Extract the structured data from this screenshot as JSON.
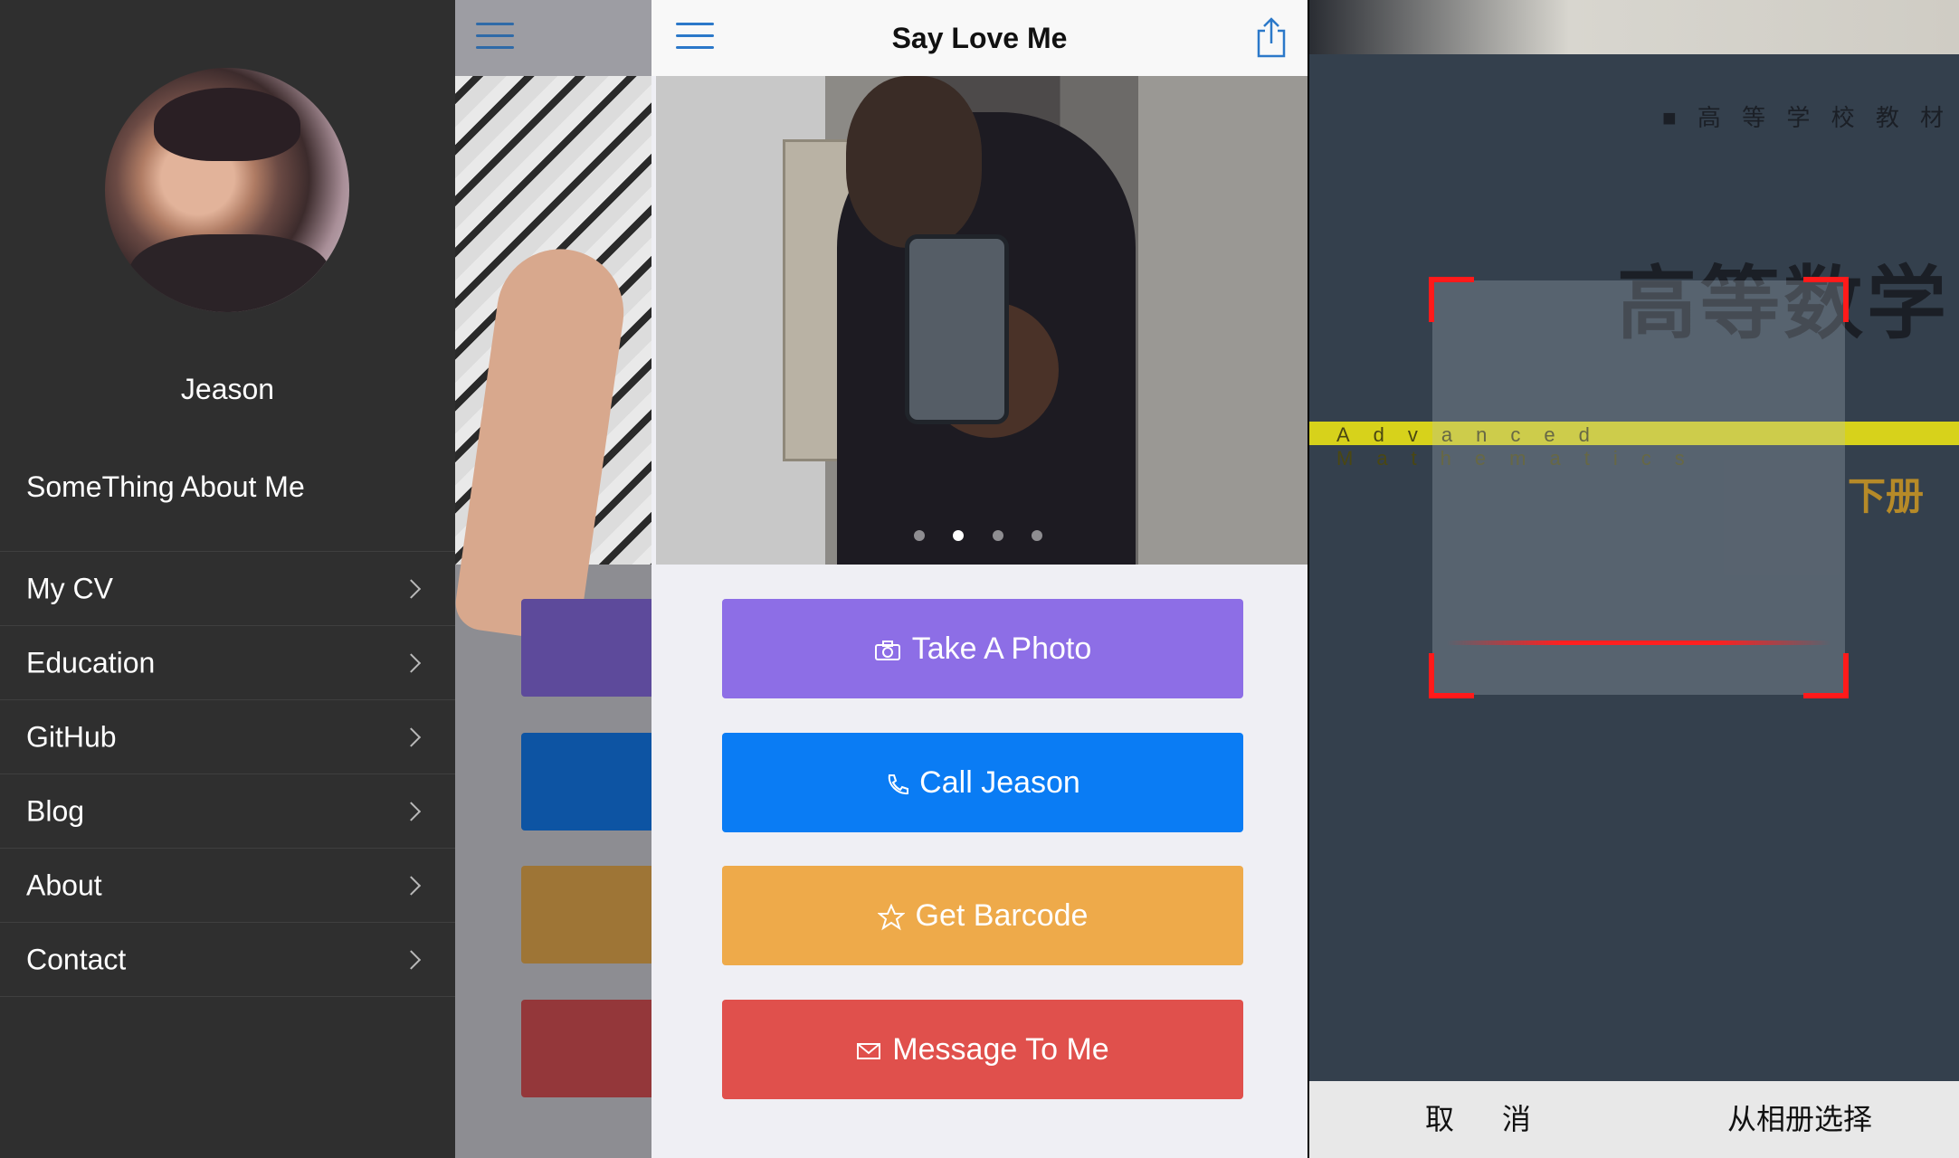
{
  "drawer": {
    "profile_name": "Jeason",
    "section_title": "SomeThing About Me",
    "items": [
      {
        "label": "My CV"
      },
      {
        "label": "Education"
      },
      {
        "label": "GitHub"
      },
      {
        "label": "Blog"
      },
      {
        "label": "About"
      },
      {
        "label": "Contact"
      }
    ]
  },
  "main": {
    "title": "Say Love Me",
    "carousel": {
      "page_count": 4,
      "current_page": 2
    },
    "actions": [
      {
        "label": "Take A Photo",
        "icon": "camera-icon",
        "color": "#8d6ee6"
      },
      {
        "label": "Call Jeason",
        "icon": "phone-icon",
        "color": "#0a7cf4"
      },
      {
        "label": "Get Barcode",
        "icon": "star-icon",
        "color": "#eeaa4a"
      },
      {
        "label": "Message To Me",
        "icon": "mail-icon",
        "color": "#e0504c"
      }
    ]
  },
  "scanner": {
    "book_series": "■ 高 等 学 校 教 材",
    "book_title": "高等数学",
    "book_english": "Advanced Mathematics",
    "book_volume": "下册",
    "cancel_label": "取 消",
    "album_label": "从相册选择"
  },
  "colors": {
    "drawer_bg": "#2f2f2f",
    "accent": "#2b78c9",
    "scan_frame": "#ff1a1a"
  }
}
